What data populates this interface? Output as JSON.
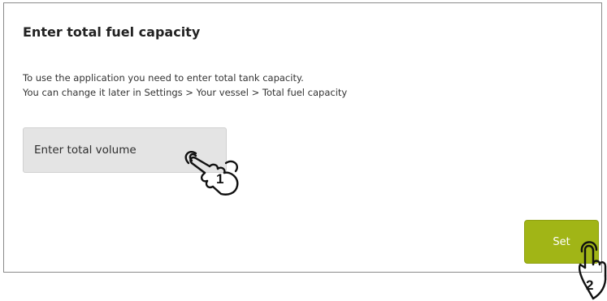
{
  "dialog": {
    "title": "Enter total fuel capacity",
    "description_line1": "To use the application you need to enter total tank capacity.",
    "description_line2": "You can change it later in Settings > Your vessel > Total fuel capacity"
  },
  "volume_field": {
    "placeholder": "Enter total volume",
    "value": ""
  },
  "set_button": {
    "label": "Set"
  },
  "gestures": [
    {
      "icon": "tap-hand-icon",
      "step": "1"
    },
    {
      "icon": "tap-hand-icon",
      "step": "2"
    }
  ],
  "colors": {
    "accent": "#a1b516",
    "input_background": "#e4e4e4",
    "border": "#8a8a8a"
  }
}
